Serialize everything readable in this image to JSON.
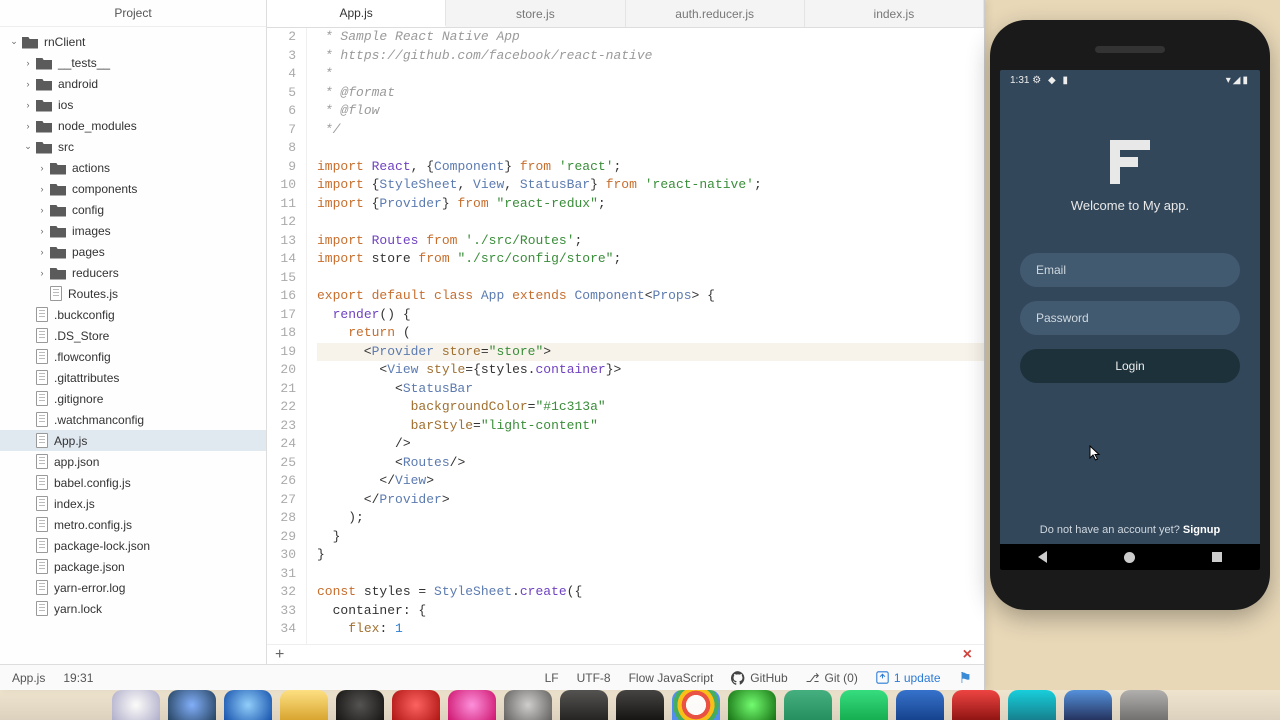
{
  "project_panel": {
    "title": "Project",
    "tree": [
      {
        "depth": 0,
        "type": "folder",
        "open": true,
        "label": "rnClient"
      },
      {
        "depth": 1,
        "type": "folder",
        "open": false,
        "label": "__tests__"
      },
      {
        "depth": 1,
        "type": "folder",
        "open": false,
        "label": "android"
      },
      {
        "depth": 1,
        "type": "folder",
        "open": false,
        "label": "ios"
      },
      {
        "depth": 1,
        "type": "folder",
        "open": false,
        "label": "node_modules"
      },
      {
        "depth": 1,
        "type": "folder",
        "open": true,
        "label": "src"
      },
      {
        "depth": 2,
        "type": "folder",
        "open": false,
        "label": "actions"
      },
      {
        "depth": 2,
        "type": "folder",
        "open": false,
        "label": "components"
      },
      {
        "depth": 2,
        "type": "folder",
        "open": false,
        "label": "config"
      },
      {
        "depth": 2,
        "type": "folder",
        "open": false,
        "label": "images"
      },
      {
        "depth": 2,
        "type": "folder",
        "open": false,
        "label": "pages"
      },
      {
        "depth": 2,
        "type": "folder",
        "open": false,
        "label": "reducers"
      },
      {
        "depth": 2,
        "type": "file",
        "label": "Routes.js"
      },
      {
        "depth": 1,
        "type": "file",
        "label": ".buckconfig"
      },
      {
        "depth": 1,
        "type": "file",
        "label": ".DS_Store"
      },
      {
        "depth": 1,
        "type": "file",
        "label": ".flowconfig"
      },
      {
        "depth": 1,
        "type": "file",
        "label": ".gitattributes"
      },
      {
        "depth": 1,
        "type": "file",
        "label": ".gitignore"
      },
      {
        "depth": 1,
        "type": "file",
        "label": ".watchmanconfig"
      },
      {
        "depth": 1,
        "type": "file",
        "label": "App.js",
        "active": true
      },
      {
        "depth": 1,
        "type": "file",
        "label": "app.json"
      },
      {
        "depth": 1,
        "type": "file",
        "label": "babel.config.js"
      },
      {
        "depth": 1,
        "type": "file",
        "label": "index.js"
      },
      {
        "depth": 1,
        "type": "file",
        "label": "metro.config.js"
      },
      {
        "depth": 1,
        "type": "file",
        "label": "package-lock.json"
      },
      {
        "depth": 1,
        "type": "file",
        "label": "package.json"
      },
      {
        "depth": 1,
        "type": "file",
        "label": "yarn-error.log"
      },
      {
        "depth": 1,
        "type": "file",
        "label": "yarn.lock"
      }
    ]
  },
  "tabs": [
    {
      "label": "App.js",
      "active": true
    },
    {
      "label": "store.js"
    },
    {
      "label": "auth.reducer.js"
    },
    {
      "label": "index.js"
    }
  ],
  "code": {
    "first_line": 2,
    "highlight_line": 19,
    "lines": [
      {
        "n": 2,
        "html": " <span class='cm'>* Sample React Native App</span>"
      },
      {
        "n": 3,
        "html": " <span class='cm'>* https://github.com/facebook/react-native</span>"
      },
      {
        "n": 4,
        "html": " <span class='cm'>*</span>"
      },
      {
        "n": 5,
        "html": " <span class='cm'>* @format</span>"
      },
      {
        "n": 6,
        "html": " <span class='cm'>* @flow</span>"
      },
      {
        "n": 7,
        "html": " <span class='cm'>*/</span>"
      },
      {
        "n": 8,
        "html": ""
      },
      {
        "n": 9,
        "html": "<span class='kw'>import</span> <span class='id'>React</span>, {<span class='cls'>Component</span>} <span class='kw'>from</span> <span class='str'>'react'</span>;"
      },
      {
        "n": 10,
        "html": "<span class='kw'>import</span> {<span class='cls'>StyleSheet</span>, <span class='cls'>View</span>, <span class='cls'>StatusBar</span>} <span class='kw'>from</span> <span class='str'>'react-native'</span>;"
      },
      {
        "n": 11,
        "html": "<span class='kw'>import</span> {<span class='cls'>Provider</span>} <span class='kw'>from</span> <span class='str'>\"react-redux\"</span>;"
      },
      {
        "n": 12,
        "html": ""
      },
      {
        "n": 13,
        "html": "<span class='kw'>import</span> <span class='id'>Routes</span> <span class='kw'>from</span> <span class='str'>'./src/Routes'</span>;"
      },
      {
        "n": 14,
        "html": "<span class='kw'>import</span> store <span class='kw'>from</span> <span class='str'>\"./src/config/store\"</span>;"
      },
      {
        "n": 15,
        "html": ""
      },
      {
        "n": 16,
        "html": "<span class='kw'>export default class</span> <span class='cls'>App</span> <span class='kw'>extends</span> <span class='cls'>Component</span>&lt;<span class='cls'>Props</span>&gt; {"
      },
      {
        "n": 17,
        "html": "  <span class='id'>render</span>() {"
      },
      {
        "n": 18,
        "html": "    <span class='kw'>return</span> ("
      },
      {
        "n": 19,
        "html": "      &lt;<span class='cls'>Provider</span> <span class='attr'>store</span>=<span class='str'>\"store\"</span>&gt;"
      },
      {
        "n": 20,
        "html": "        &lt;<span class='cls'>View</span> <span class='attr'>style</span>={styles.<span class='id'>container</span>}&gt;"
      },
      {
        "n": 21,
        "html": "          &lt;<span class='cls'>StatusBar</span>"
      },
      {
        "n": 22,
        "html": "            <span class='attr'>backgroundColor</span>=<span class='str'>\"#1c313a\"</span>"
      },
      {
        "n": 23,
        "html": "            <span class='attr'>barStyle</span>=<span class='str'>\"light-content\"</span>"
      },
      {
        "n": 24,
        "html": "          /&gt;"
      },
      {
        "n": 25,
        "html": "          &lt;<span class='cls'>Routes</span>/&gt;"
      },
      {
        "n": 26,
        "html": "        &lt;/<span class='cls'>View</span>&gt;"
      },
      {
        "n": 27,
        "html": "      &lt;/<span class='cls'>Provider</span>&gt;"
      },
      {
        "n": 28,
        "html": "    );"
      },
      {
        "n": 29,
        "html": "  }"
      },
      {
        "n": 30,
        "html": "}"
      },
      {
        "n": 31,
        "html": ""
      },
      {
        "n": 32,
        "html": "<span class='kw'>const</span> styles = <span class='cls'>StyleSheet</span>.<span class='id'>create</span>({"
      },
      {
        "n": 33,
        "html": "  container: {"
      },
      {
        "n": 34,
        "html": "    <span class='attr'>flex</span>: <span class='num'>1</span>"
      }
    ]
  },
  "status": {
    "file": "App.js",
    "cursor": "19:31",
    "eol": "LF",
    "encoding": "UTF-8",
    "lang": "Flow JavaScript",
    "github": "GitHub",
    "git": "Git (0)",
    "update": "1 update"
  },
  "emulator": {
    "time": "1:31",
    "welcome": "Welcome to My app.",
    "email_ph": "Email",
    "password_ph": "Password",
    "login": "Login",
    "signup_prompt": "Do not have an account yet? ",
    "signup": "Signup"
  }
}
